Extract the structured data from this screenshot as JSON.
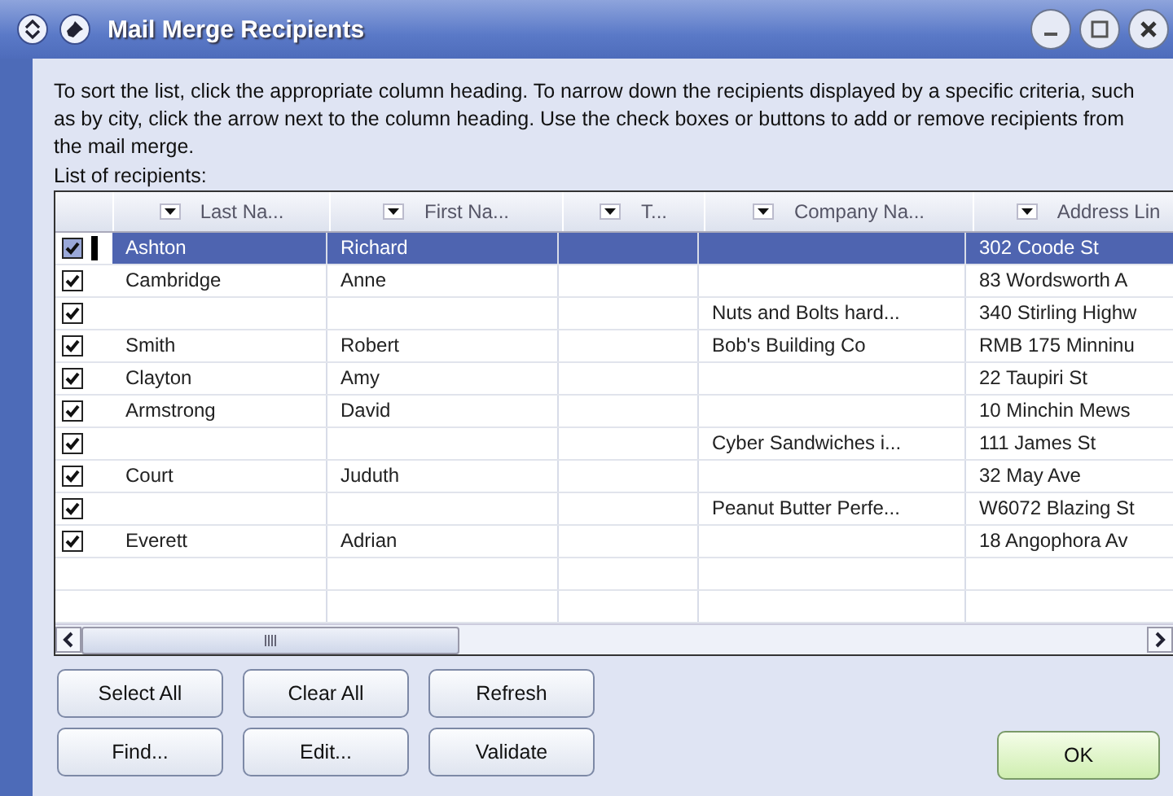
{
  "window": {
    "title": "Mail Merge Recipients"
  },
  "instructions": "To sort the list, click the appropriate column heading.  To narrow down the recipients displayed by a specific criteria, such as by city, click the arrow next to the column heading.  Use the check boxes or buttons to add or remove recipients from the mail merge.",
  "list_label": "List of recipients:",
  "table": {
    "columns": [
      {
        "label": "Last Na..."
      },
      {
        "label": "First Na..."
      },
      {
        "label": "T..."
      },
      {
        "label": "Company Na..."
      },
      {
        "label": "Address Lin"
      }
    ],
    "rows": [
      {
        "checked": true,
        "selected": true,
        "cells": [
          "Ashton",
          "Richard",
          null,
          null,
          "302 Coode St"
        ]
      },
      {
        "checked": true,
        "selected": false,
        "cells": [
          "Cambridge",
          "Anne",
          null,
          null,
          "83 Wordsworth A"
        ]
      },
      {
        "checked": true,
        "selected": false,
        "cells": [
          null,
          null,
          null,
          "Nuts and Bolts hard...",
          "340 Stirling Highw"
        ]
      },
      {
        "checked": true,
        "selected": false,
        "cells": [
          "Smith",
          "Robert",
          null,
          "Bob's Building Co",
          "RMB 175 Minninu"
        ]
      },
      {
        "checked": true,
        "selected": false,
        "cells": [
          "Clayton",
          "Amy",
          null,
          null,
          "22 Taupiri St"
        ]
      },
      {
        "checked": true,
        "selected": false,
        "cells": [
          "Armstrong",
          "David",
          null,
          null,
          "10 Minchin Mews"
        ]
      },
      {
        "checked": true,
        "selected": false,
        "cells": [
          null,
          null,
          null,
          "Cyber Sandwiches i...",
          "111 James St"
        ]
      },
      {
        "checked": true,
        "selected": false,
        "cells": [
          "Court",
          "Juduth",
          null,
          null,
          "32 May Ave"
        ]
      },
      {
        "checked": true,
        "selected": false,
        "cells": [
          null,
          null,
          null,
          "Peanut Butter Perfe...",
          "W6072 Blazing St"
        ]
      },
      {
        "checked": true,
        "selected": false,
        "cells": [
          "Everett",
          "Adrian",
          null,
          null,
          "18 Angophora Av"
        ]
      }
    ]
  },
  "buttons": [
    {
      "label": "Select All"
    },
    {
      "label": "Clear All"
    },
    {
      "label": "Refresh"
    },
    {
      "label": "Find..."
    },
    {
      "label": "Edit..."
    },
    {
      "label": "Validate"
    }
  ],
  "ok_button": {
    "label": "OK"
  }
}
